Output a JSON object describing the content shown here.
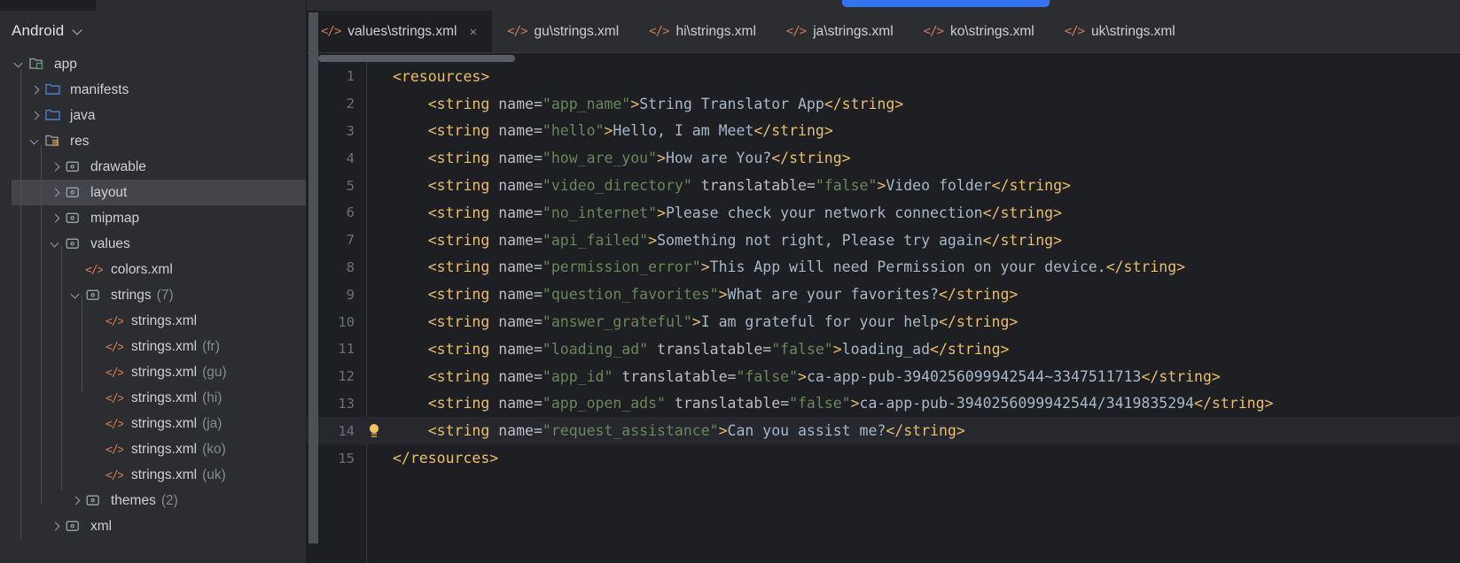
{
  "colors": {
    "accent_blue": "#3574f0",
    "xml_icon": "#cf7c52",
    "tag": "#e8bf6a",
    "attr_value": "#6a8759",
    "text_body": "#a9b7c6",
    "sidebar_bg": "#2b2d30",
    "editor_bg": "#1e1f22",
    "selection": "#43454a",
    "bulb": "#f2c55c"
  },
  "sidebar": {
    "title": "Android",
    "chevron_icon": "chevron-down-icon",
    "tree": [
      {
        "label": "app",
        "sub": "",
        "depth": 0,
        "twisty": "down",
        "icon": "module-folder-icon",
        "selected": false
      },
      {
        "label": "manifests",
        "sub": "",
        "depth": 1,
        "twisty": "right",
        "icon": "folder-blue-icon",
        "selected": false
      },
      {
        "label": "java",
        "sub": "",
        "depth": 1,
        "twisty": "right",
        "icon": "folder-blue-icon",
        "selected": false
      },
      {
        "label": "res",
        "sub": "",
        "depth": 1,
        "twisty": "down",
        "icon": "res-folder-icon",
        "selected": false
      },
      {
        "label": "drawable",
        "sub": "",
        "depth": 2,
        "twisty": "right",
        "icon": "resource-folder-icon",
        "selected": false
      },
      {
        "label": "layout",
        "sub": "",
        "depth": 2,
        "twisty": "right",
        "icon": "resource-folder-icon",
        "selected": true
      },
      {
        "label": "mipmap",
        "sub": "",
        "depth": 2,
        "twisty": "right",
        "icon": "resource-folder-icon",
        "selected": false
      },
      {
        "label": "values",
        "sub": "",
        "depth": 2,
        "twisty": "down",
        "icon": "resource-folder-icon",
        "selected": false
      },
      {
        "label": "colors.xml",
        "sub": "",
        "depth": 3,
        "twisty": "none",
        "icon": "xml-file-icon",
        "selected": false
      },
      {
        "label": "strings",
        "sub": "(7)",
        "depth": 3,
        "twisty": "down",
        "icon": "resource-folder-icon",
        "selected": false
      },
      {
        "label": "strings.xml",
        "sub": "",
        "depth": 4,
        "twisty": "none",
        "icon": "xml-file-icon",
        "selected": false
      },
      {
        "label": "strings.xml",
        "sub": "(fr)",
        "depth": 4,
        "twisty": "none",
        "icon": "xml-file-icon",
        "selected": false
      },
      {
        "label": "strings.xml",
        "sub": "(gu)",
        "depth": 4,
        "twisty": "none",
        "icon": "xml-file-icon",
        "selected": false
      },
      {
        "label": "strings.xml",
        "sub": "(hi)",
        "depth": 4,
        "twisty": "none",
        "icon": "xml-file-icon",
        "selected": false
      },
      {
        "label": "strings.xml",
        "sub": "(ja)",
        "depth": 4,
        "twisty": "none",
        "icon": "xml-file-icon",
        "selected": false
      },
      {
        "label": "strings.xml",
        "sub": "(ko)",
        "depth": 4,
        "twisty": "none",
        "icon": "xml-file-icon",
        "selected": false
      },
      {
        "label": "strings.xml",
        "sub": "(uk)",
        "depth": 4,
        "twisty": "none",
        "icon": "xml-file-icon",
        "selected": false
      },
      {
        "label": "themes",
        "sub": "(2)",
        "depth": 3,
        "twisty": "right",
        "icon": "resource-folder-icon",
        "selected": false
      },
      {
        "label": "xml",
        "sub": "",
        "depth": 2,
        "twisty": "right",
        "icon": "resource-folder-icon",
        "selected": false
      }
    ]
  },
  "tabs": [
    {
      "label": "values\\strings.xml",
      "active": true,
      "icon": "xml-file-icon",
      "close_icon": "close-icon",
      "close_glyph": "×"
    },
    {
      "label": "gu\\strings.xml",
      "active": false,
      "icon": "xml-file-icon"
    },
    {
      "label": "hi\\strings.xml",
      "active": false,
      "icon": "xml-file-icon"
    },
    {
      "label": "ja\\strings.xml",
      "active": false,
      "icon": "xml-file-icon"
    },
    {
      "label": "ko\\strings.xml",
      "active": false,
      "icon": "xml-file-icon"
    },
    {
      "label": "uk\\strings.xml",
      "active": false,
      "icon": "xml-file-icon"
    }
  ],
  "editor": {
    "xml_icon_glyph": "</>",
    "lines": [
      {
        "n": "1",
        "current": false,
        "bulb": false,
        "tokens": [
          {
            "t": "tag",
            "s": "<resources>"
          }
        ]
      },
      {
        "n": "2",
        "current": false,
        "bulb": false,
        "tokens": [
          {
            "t": "plain",
            "s": "    "
          },
          {
            "t": "tag",
            "s": "<string"
          },
          {
            "t": "attr",
            "s": " name="
          },
          {
            "t": "val",
            "s": "\"app_name\""
          },
          {
            "t": "tag",
            "s": ">"
          },
          {
            "t": "body",
            "s": "String Translator App"
          },
          {
            "t": "tag",
            "s": "</string>"
          }
        ]
      },
      {
        "n": "3",
        "current": false,
        "bulb": false,
        "tokens": [
          {
            "t": "plain",
            "s": "    "
          },
          {
            "t": "tag",
            "s": "<string"
          },
          {
            "t": "attr",
            "s": " name="
          },
          {
            "t": "val",
            "s": "\"hello\""
          },
          {
            "t": "tag",
            "s": ">"
          },
          {
            "t": "body",
            "s": "Hello, I am Meet"
          },
          {
            "t": "tag",
            "s": "</string>"
          }
        ]
      },
      {
        "n": "4",
        "current": false,
        "bulb": false,
        "tokens": [
          {
            "t": "plain",
            "s": "    "
          },
          {
            "t": "tag",
            "s": "<string"
          },
          {
            "t": "attr",
            "s": " name="
          },
          {
            "t": "val",
            "s": "\"how_are_you\""
          },
          {
            "t": "tag",
            "s": ">"
          },
          {
            "t": "body",
            "s": "How are You?"
          },
          {
            "t": "tag",
            "s": "</string>"
          }
        ]
      },
      {
        "n": "5",
        "current": false,
        "bulb": false,
        "tokens": [
          {
            "t": "plain",
            "s": "    "
          },
          {
            "t": "tag",
            "s": "<string"
          },
          {
            "t": "attr",
            "s": " name="
          },
          {
            "t": "val",
            "s": "\"video_directory\""
          },
          {
            "t": "attr",
            "s": " translatable="
          },
          {
            "t": "val",
            "s": "\"false\""
          },
          {
            "t": "tag",
            "s": ">"
          },
          {
            "t": "body",
            "s": "Video folder"
          },
          {
            "t": "tag",
            "s": "</string>"
          }
        ]
      },
      {
        "n": "6",
        "current": false,
        "bulb": false,
        "tokens": [
          {
            "t": "plain",
            "s": "    "
          },
          {
            "t": "tag",
            "s": "<string"
          },
          {
            "t": "attr",
            "s": " name="
          },
          {
            "t": "val",
            "s": "\"no_internet\""
          },
          {
            "t": "tag",
            "s": ">"
          },
          {
            "t": "body",
            "s": "Please check your network connection"
          },
          {
            "t": "tag",
            "s": "</string>"
          }
        ]
      },
      {
        "n": "7",
        "current": false,
        "bulb": false,
        "tokens": [
          {
            "t": "plain",
            "s": "    "
          },
          {
            "t": "tag",
            "s": "<string"
          },
          {
            "t": "attr",
            "s": " name="
          },
          {
            "t": "val",
            "s": "\"api_failed\""
          },
          {
            "t": "tag",
            "s": ">"
          },
          {
            "t": "body",
            "s": "Something not right, Please try again"
          },
          {
            "t": "tag",
            "s": "</string>"
          }
        ]
      },
      {
        "n": "8",
        "current": false,
        "bulb": false,
        "tokens": [
          {
            "t": "plain",
            "s": "    "
          },
          {
            "t": "tag",
            "s": "<string"
          },
          {
            "t": "attr",
            "s": " name="
          },
          {
            "t": "val",
            "s": "\"permission_error\""
          },
          {
            "t": "tag",
            "s": ">"
          },
          {
            "t": "body",
            "s": "This App will need Permission on your device."
          },
          {
            "t": "tag",
            "s": "</string>"
          }
        ]
      },
      {
        "n": "9",
        "current": false,
        "bulb": false,
        "tokens": [
          {
            "t": "plain",
            "s": "    "
          },
          {
            "t": "tag",
            "s": "<string"
          },
          {
            "t": "attr",
            "s": " name="
          },
          {
            "t": "val",
            "s": "\"question_favorites\""
          },
          {
            "t": "tag",
            "s": ">"
          },
          {
            "t": "body",
            "s": "What are your favorites?"
          },
          {
            "t": "tag",
            "s": "</string>"
          }
        ]
      },
      {
        "n": "10",
        "current": false,
        "bulb": false,
        "tokens": [
          {
            "t": "plain",
            "s": "    "
          },
          {
            "t": "tag",
            "s": "<string"
          },
          {
            "t": "attr",
            "s": " name="
          },
          {
            "t": "val",
            "s": "\"answer_grateful\""
          },
          {
            "t": "tag",
            "s": ">"
          },
          {
            "t": "body",
            "s": "I am grateful for your help"
          },
          {
            "t": "tag",
            "s": "</string>"
          }
        ]
      },
      {
        "n": "11",
        "current": false,
        "bulb": false,
        "tokens": [
          {
            "t": "plain",
            "s": "    "
          },
          {
            "t": "tag",
            "s": "<string"
          },
          {
            "t": "attr",
            "s": " name="
          },
          {
            "t": "val",
            "s": "\"loading_ad\""
          },
          {
            "t": "attr",
            "s": " translatable="
          },
          {
            "t": "val",
            "s": "\"false\""
          },
          {
            "t": "tag",
            "s": ">"
          },
          {
            "t": "body",
            "s": "loading_ad"
          },
          {
            "t": "tag",
            "s": "</string>"
          }
        ]
      },
      {
        "n": "12",
        "current": false,
        "bulb": false,
        "tokens": [
          {
            "t": "plain",
            "s": "    "
          },
          {
            "t": "tag",
            "s": "<string"
          },
          {
            "t": "attr",
            "s": " name="
          },
          {
            "t": "val",
            "s": "\"app_id\""
          },
          {
            "t": "attr",
            "s": " translatable="
          },
          {
            "t": "val",
            "s": "\"false\""
          },
          {
            "t": "tag",
            "s": ">"
          },
          {
            "t": "body",
            "s": "ca-app-pub-3940256099942544~3347511713"
          },
          {
            "t": "tag",
            "s": "</string>"
          }
        ]
      },
      {
        "n": "13",
        "current": false,
        "bulb": false,
        "tokens": [
          {
            "t": "plain",
            "s": "    "
          },
          {
            "t": "tag",
            "s": "<string"
          },
          {
            "t": "attr",
            "s": " name="
          },
          {
            "t": "val",
            "s": "\"app_open_ads\""
          },
          {
            "t": "attr",
            "s": " translatable="
          },
          {
            "t": "val",
            "s": "\"false\""
          },
          {
            "t": "tag",
            "s": ">"
          },
          {
            "t": "body",
            "s": "ca-app-pub-3940256099942544/3419835294"
          },
          {
            "t": "tag",
            "s": "</string>"
          }
        ]
      },
      {
        "n": "14",
        "current": true,
        "bulb": true,
        "bulb_icon": "lightbulb-intention-icon",
        "tokens": [
          {
            "t": "plain",
            "s": "    "
          },
          {
            "t": "tag",
            "s": "<string"
          },
          {
            "t": "attr",
            "s": " name="
          },
          {
            "t": "val",
            "s": "\"request_assistance\""
          },
          {
            "t": "tag",
            "s": ">"
          },
          {
            "t": "body",
            "s": "Can you assist me?"
          },
          {
            "t": "tag",
            "s": "</string>"
          }
        ]
      },
      {
        "n": "15",
        "current": false,
        "bulb": false,
        "tokens": [
          {
            "t": "tag",
            "s": "</resources>"
          }
        ]
      }
    ]
  }
}
